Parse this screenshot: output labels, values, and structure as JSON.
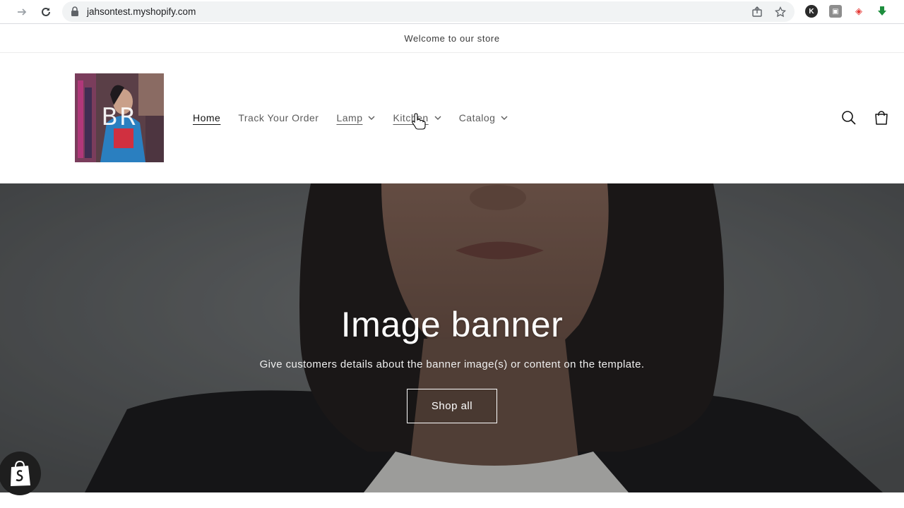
{
  "browser": {
    "url": "jahsontest.myshopify.com"
  },
  "announcement": {
    "text": "Welcome to our store"
  },
  "header": {
    "logo_letters": "BR",
    "nav": [
      {
        "label": "Home",
        "has_dropdown": false
      },
      {
        "label": "Track Your Order",
        "has_dropdown": false
      },
      {
        "label": "Lamp",
        "has_dropdown": true
      },
      {
        "label": "Kitchen",
        "has_dropdown": true
      },
      {
        "label": "Catalog",
        "has_dropdown": true
      }
    ],
    "icons": [
      "search-icon",
      "cart-icon"
    ]
  },
  "banner": {
    "title": "Image banner",
    "text": "Give customers details about the banner image(s) or content on the template.",
    "button_label": "Shop all"
  },
  "colors": {
    "text": "#121212",
    "nav_text": "#5c5c5c",
    "banner_overlay": "#6a6e70",
    "omnibox": "#f1f3f4"
  }
}
